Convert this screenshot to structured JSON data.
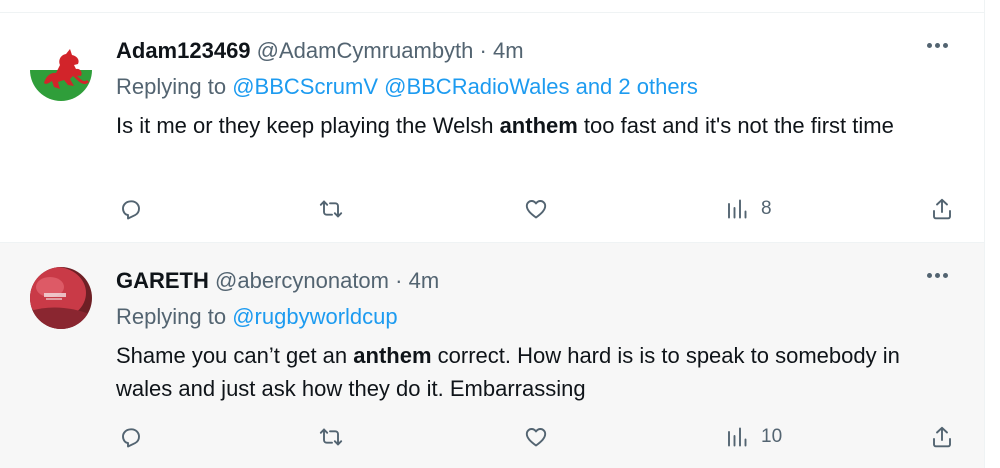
{
  "tweets": [
    {
      "name": "Adam123469",
      "handle": "@AdamCymruambyth",
      "separator": "·",
      "time": "4m",
      "replying_prefix": "Replying to",
      "replying_mentions": "@BBCScrumV @BBCRadioWales and 2 others",
      "text_before": "Is it me or they keep playing the Welsh ",
      "text_bold": "anthem",
      "text_after": " too fast and it's not the first time",
      "views": "8",
      "avatar": "welsh-dragon-flag"
    },
    {
      "name": "GARETH",
      "handle": "@abercynonatom",
      "separator": "·",
      "time": "4m",
      "replying_prefix": "Replying to",
      "replying_mentions": "@rugbyworldcup",
      "text_before": "Shame you can’t get an ",
      "text_bold": "anthem",
      "text_after": " correct. How hard is is to speak to somebody in wales and just ask how they do it. Embarrassing",
      "views": "10",
      "avatar": "red-cap-photo"
    }
  ],
  "icons": {
    "more": "more-horizontal-icon",
    "reply": "reply-icon",
    "retweet": "retweet-icon",
    "like": "heart-icon",
    "views": "views-icon",
    "share": "share-icon"
  },
  "colors": {
    "text": "#0f1419",
    "muted": "#536471",
    "link": "#1d9bf0",
    "highlight_bg": "#f7f7f7"
  }
}
